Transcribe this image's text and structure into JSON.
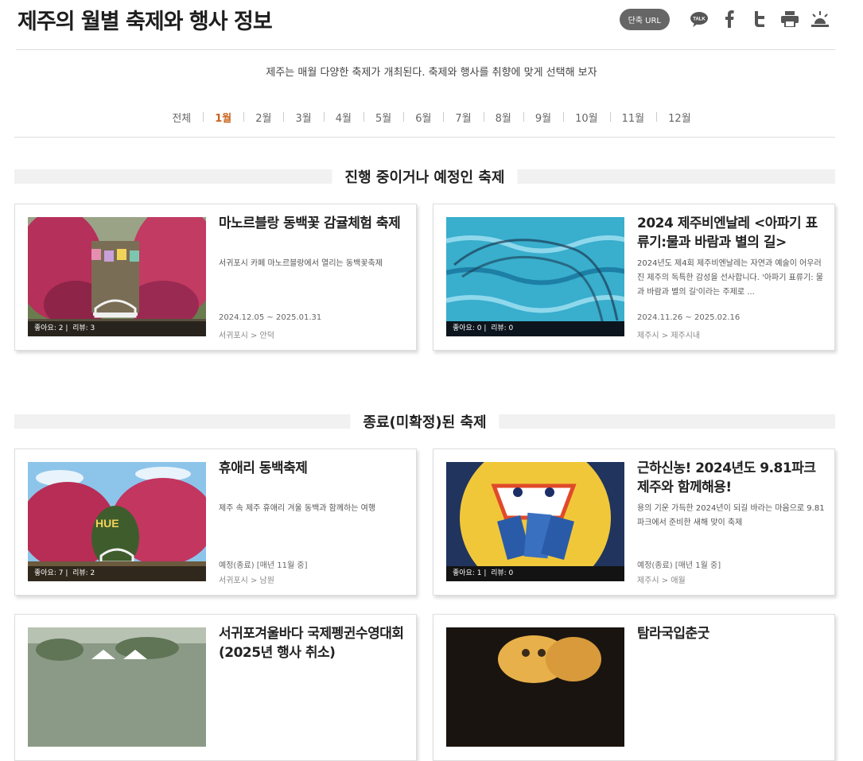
{
  "header": {
    "title": "제주의 월별 축제와 행사 정보",
    "short_url": "단축 URL",
    "talk_label": "TALK"
  },
  "intro": "제주는 매월 다양한 축제가 개최된다. 축제와 행사를 취향에 맞게 선택해 보자",
  "months": [
    "전체",
    "1월",
    "2월",
    "3월",
    "4월",
    "5월",
    "6월",
    "7월",
    "8월",
    "9월",
    "10월",
    "11월",
    "12월"
  ],
  "active_month": "1월",
  "accent_color": "#c8641e",
  "sections": {
    "ongoing": "진행 중이거나 예정인 축제",
    "ended": "종료(미확정)된 축제"
  },
  "cards": [
    {
      "title": "마노르블랑 동백꽃 감귤체험 축제",
      "desc": "서귀포시 카페 마노르블랑에서 열리는 동백꽃축제",
      "date": "2024.12.05 ~ 2025.01.31",
      "loc": "서귀포시 > 안덕",
      "likes": "좋아요: 2",
      "reviews": "리뷰: 3"
    },
    {
      "title": "2024 제주비엔날레 <아파기 표류기:물과 바람과 별의 길>",
      "desc": "2024년도 제4회 제주비엔날레는 자연과 예술이 어우러진 제주의 독특한 감성을 선사합니다. '아파기 표류기: 물과 바람과 별의 길'이라는 주제로 ...",
      "date": "2024.11.26 ~ 2025.02.16",
      "loc": "제주시 > 제주시내",
      "likes": "좋아요: 0",
      "reviews": "리뷰: 0"
    },
    {
      "title": "휴애리 동백축제",
      "desc": "제주 속 제주 휴애리 겨울 동백과 함께하는 여행",
      "date": "예정(종료) [매년 11월 중]",
      "loc": "서귀포시 > 남원",
      "likes": "좋아요: 7",
      "reviews": "리뷰: 2"
    },
    {
      "title": "근하신농! 2024년도 9.81파크 제주와 함께해용!",
      "desc": "용의 기운 가득한 2024년이 되길 바라는 마음으로 9.81파크에서 준비한 새해 맞이 축제",
      "date": "예정(종료) [매년 1월 중]",
      "loc": "제주시 > 애월",
      "likes": "좋아요: 1",
      "reviews": "리뷰: 0"
    },
    {
      "title": "서귀포겨울바다 국제펭귄수영대회 (2025년 행사 취소)"
    },
    {
      "title": "탐라국입춘굿"
    }
  ]
}
